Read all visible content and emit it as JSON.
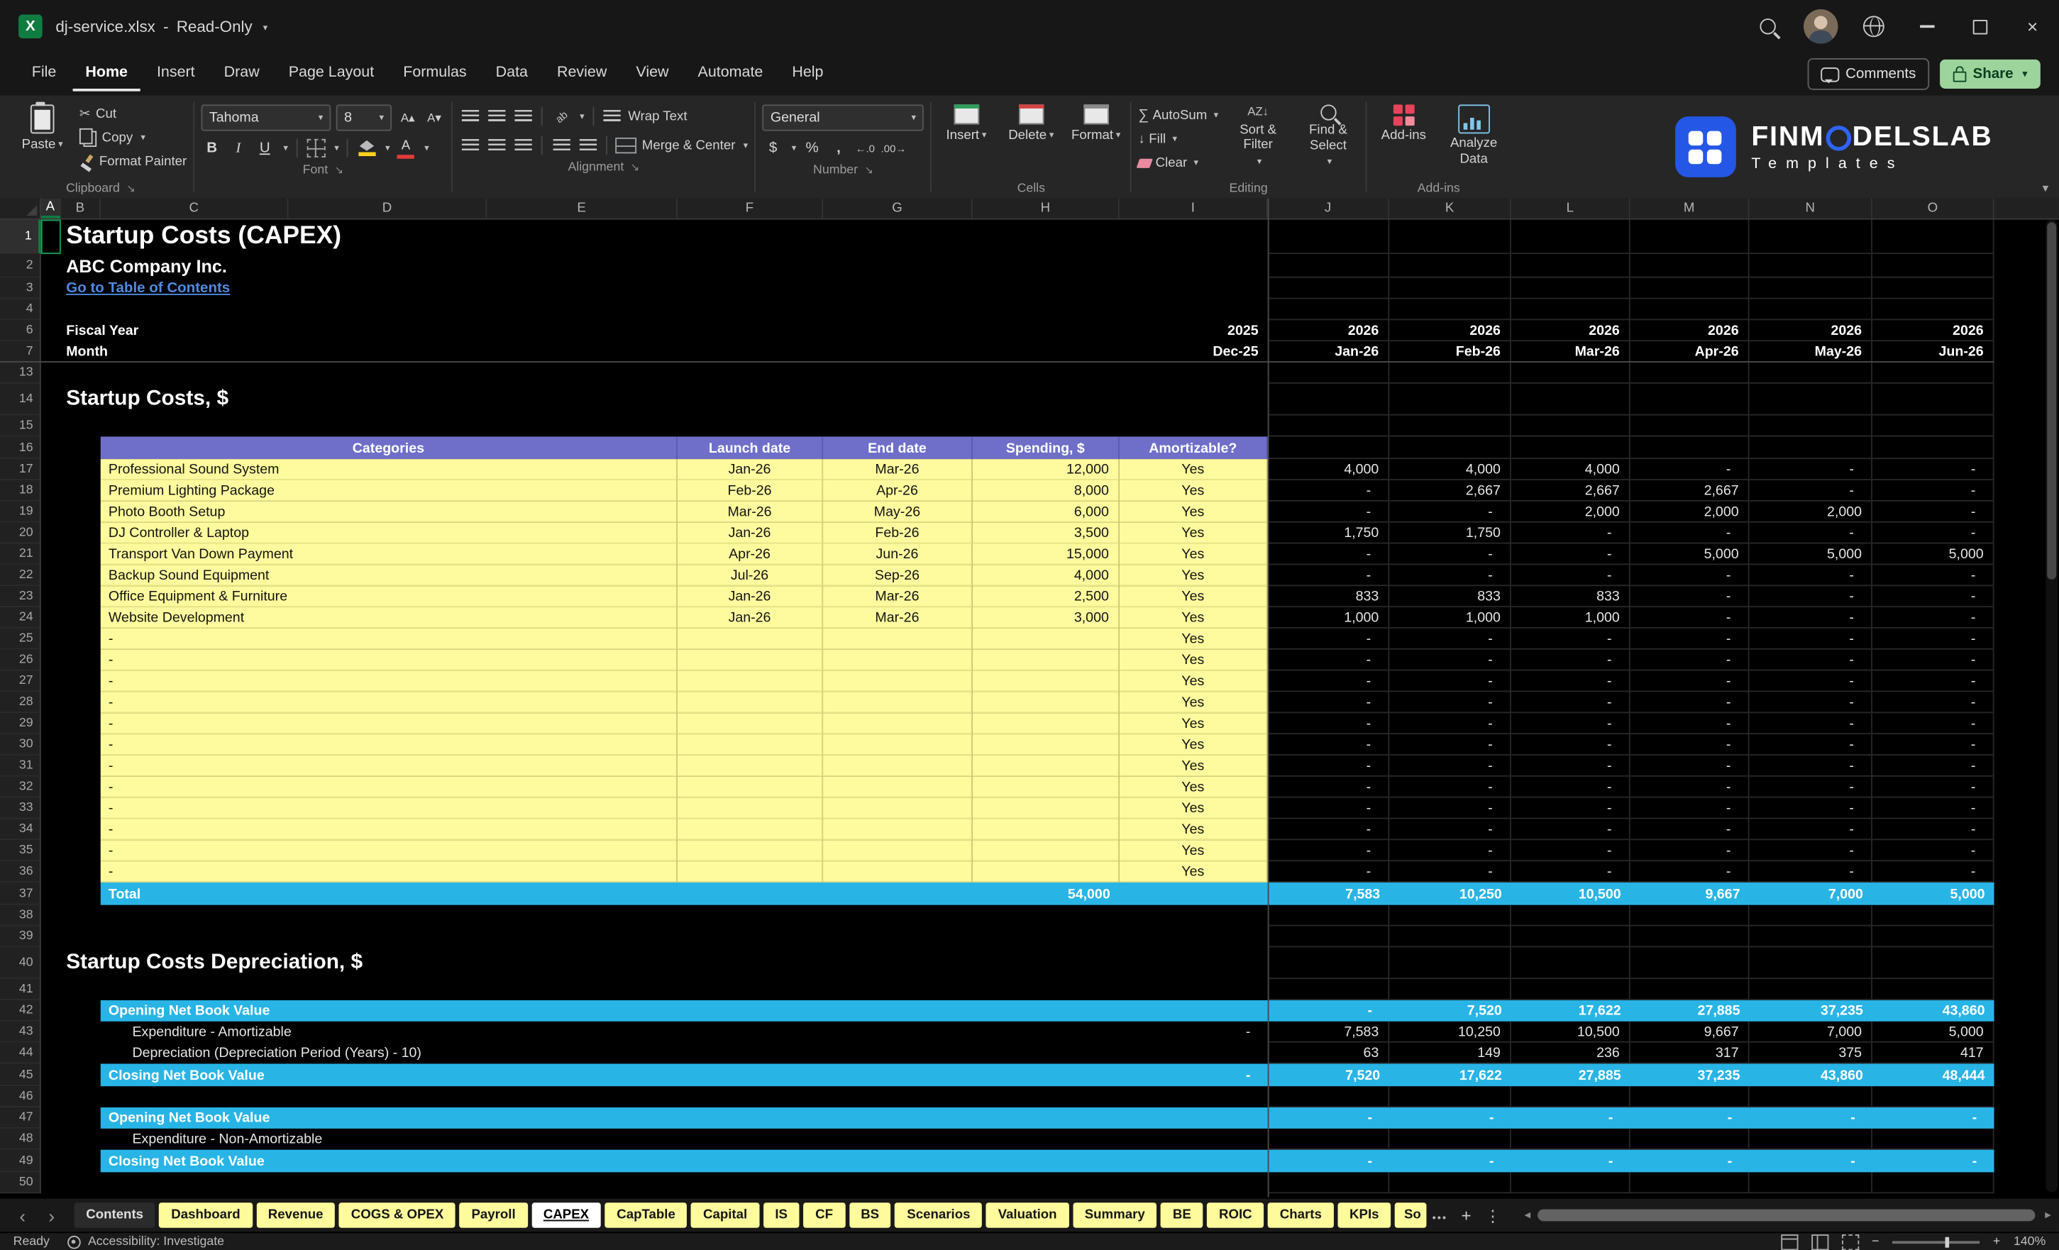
{
  "window": {
    "title": "dj-service.xlsx",
    "dash": "-",
    "mode": "Read-Only"
  },
  "menu": {
    "items": [
      "File",
      "Home",
      "Insert",
      "Draw",
      "Page Layout",
      "Formulas",
      "Data",
      "Review",
      "View",
      "Automate",
      "Help"
    ],
    "active_item": "Home",
    "comments_label": "Comments",
    "share_label": "Share"
  },
  "ribbon": {
    "paste": "Paste",
    "cut": "Cut",
    "copy": "Copy",
    "format_painter": "Format Painter",
    "font_name": "Tahoma",
    "font_size": "8",
    "wrap_text": "Wrap Text",
    "merge_center": "Merge & Center",
    "number_format": "General",
    "insert": "Insert",
    "delete": "Delete",
    "format": "Format",
    "autosum": "AutoSum",
    "fill": "Fill",
    "clear": "Clear",
    "sort_filter": "Sort & Filter",
    "find_select": "Find & Select",
    "addins": "Add-ins",
    "analyze_data": "Analyze Data",
    "groups": {
      "clipboard": "Clipboard",
      "font": "Font",
      "alignment": "Alignment",
      "number": "Number",
      "cells": "Cells",
      "editing": "Editing",
      "addins": "Add-ins"
    },
    "brand": {
      "pre": "FINM",
      "post": "DELSLAB",
      "subtitle": "Templates"
    }
  },
  "colors": {
    "band_cyan": "#29B4E6",
    "header_purple": "#6F6FC9",
    "table_yellow": "#FEFB9E",
    "link_blue": "#4F8AE0",
    "excel_green": "#107C41"
  },
  "grid": {
    "column_letters": [
      "A",
      "B",
      "C",
      "D",
      "E",
      "F",
      "G",
      "H",
      "I",
      "J",
      "K",
      "L",
      "M",
      "N",
      "O"
    ],
    "selected_column": "A",
    "selected_row": "1",
    "rows": [
      {
        "n": "1",
        "h": 26,
        "type": "title",
        "text": "Startup Costs (CAPEX)"
      },
      {
        "n": "2",
        "h": 18,
        "type": "subtitle",
        "text": "ABC Company Inc."
      },
      {
        "n": "3",
        "h": 16,
        "type": "link",
        "text": "Go to Table of Contents"
      },
      {
        "n": "4",
        "h": 16,
        "type": "blank"
      },
      {
        "n": "6",
        "h": 16,
        "type": "years",
        "label": "Fiscal Year",
        "cells": [
          "2025",
          "2026",
          "2026",
          "2026",
          "2026",
          "2026",
          "2026"
        ]
      },
      {
        "n": "7",
        "h": 16,
        "type": "years",
        "label": "Month",
        "cells": [
          "Dec-25",
          "Jan-26",
          "Feb-26",
          "Mar-26",
          "Apr-26",
          "May-26",
          "Jun-26"
        ]
      },
      {
        "n": "13",
        "h": 16,
        "type": "blank"
      },
      {
        "n": "14",
        "h": 24,
        "type": "section",
        "text": "Startup Costs, $"
      },
      {
        "n": "15",
        "h": 16,
        "type": "blank"
      },
      {
        "n": "16",
        "h": 17,
        "type": "thead",
        "cells": [
          "Categories",
          "Launch date",
          "End date",
          "Spending, $",
          "Amortizable?"
        ]
      },
      {
        "n": "17",
        "h": 16,
        "type": "item",
        "category": "Professional Sound System",
        "launch": "Jan-26",
        "end": "Mar-26",
        "spend": "12,000",
        "amort": "Yes",
        "months": [
          "4,000",
          "4,000",
          "4,000",
          "-",
          "-",
          "-"
        ]
      },
      {
        "n": "18",
        "h": 16,
        "type": "item",
        "category": "Premium Lighting Package",
        "launch": "Feb-26",
        "end": "Apr-26",
        "spend": "8,000",
        "amort": "Yes",
        "months": [
          "-",
          "2,667",
          "2,667",
          "2,667",
          "-",
          "-"
        ]
      },
      {
        "n": "19",
        "h": 16,
        "type": "item",
        "category": "Photo Booth Setup",
        "launch": "Mar-26",
        "end": "May-26",
        "spend": "6,000",
        "amort": "Yes",
        "months": [
          "-",
          "-",
          "2,000",
          "2,000",
          "2,000",
          "-"
        ]
      },
      {
        "n": "20",
        "h": 16,
        "type": "item",
        "category": "DJ Controller & Laptop",
        "launch": "Jan-26",
        "end": "Feb-26",
        "spend": "3,500",
        "amort": "Yes",
        "months": [
          "1,750",
          "1,750",
          "-",
          "-",
          "-",
          "-"
        ]
      },
      {
        "n": "21",
        "h": 16,
        "type": "item",
        "category": "Transport Van Down Payment",
        "launch": "Apr-26",
        "end": "Jun-26",
        "spend": "15,000",
        "amort": "Yes",
        "months": [
          "-",
          "-",
          "-",
          "5,000",
          "5,000",
          "5,000"
        ]
      },
      {
        "n": "22",
        "h": 16,
        "type": "item",
        "category": "Backup Sound Equipment",
        "launch": "Jul-26",
        "end": "Sep-26",
        "spend": "4,000",
        "amort": "Yes",
        "months": [
          "-",
          "-",
          "-",
          "-",
          "-",
          "-"
        ]
      },
      {
        "n": "23",
        "h": 16,
        "type": "item",
        "category": "Office Equipment & Furniture",
        "launch": "Jan-26",
        "end": "Mar-26",
        "spend": "2,500",
        "amort": "Yes",
        "months": [
          "833",
          "833",
          "833",
          "-",
          "-",
          "-"
        ]
      },
      {
        "n": "24",
        "h": 16,
        "type": "item",
        "category": "Website Development",
        "launch": "Jan-26",
        "end": "Mar-26",
        "spend": "3,000",
        "amort": "Yes",
        "months": [
          "1,000",
          "1,000",
          "1,000",
          "-",
          "-",
          "-"
        ]
      },
      {
        "n": "25",
        "h": 16,
        "type": "item",
        "category": "-",
        "launch": "",
        "end": "",
        "spend": "",
        "amort": "Yes",
        "months": [
          "-",
          "-",
          "-",
          "-",
          "-",
          "-"
        ]
      },
      {
        "n": "26",
        "h": 16,
        "type": "item",
        "category": "-",
        "launch": "",
        "end": "",
        "spend": "",
        "amort": "Yes",
        "months": [
          "-",
          "-",
          "-",
          "-",
          "-",
          "-"
        ]
      },
      {
        "n": "27",
        "h": 16,
        "type": "item",
        "category": "-",
        "launch": "",
        "end": "",
        "spend": "",
        "amort": "Yes",
        "months": [
          "-",
          "-",
          "-",
          "-",
          "-",
          "-"
        ]
      },
      {
        "n": "28",
        "h": 16,
        "type": "item",
        "category": "-",
        "launch": "",
        "end": "",
        "spend": "",
        "amort": "Yes",
        "months": [
          "-",
          "-",
          "-",
          "-",
          "-",
          "-"
        ]
      },
      {
        "n": "29",
        "h": 16,
        "type": "item",
        "category": "-",
        "launch": "",
        "end": "",
        "spend": "",
        "amort": "Yes",
        "months": [
          "-",
          "-",
          "-",
          "-",
          "-",
          "-"
        ]
      },
      {
        "n": "30",
        "h": 16,
        "type": "item",
        "category": "-",
        "launch": "",
        "end": "",
        "spend": "",
        "amort": "Yes",
        "months": [
          "-",
          "-",
          "-",
          "-",
          "-",
          "-"
        ]
      },
      {
        "n": "31",
        "h": 16,
        "type": "item",
        "category": "-",
        "launch": "",
        "end": "",
        "spend": "",
        "amort": "Yes",
        "months": [
          "-",
          "-",
          "-",
          "-",
          "-",
          "-"
        ]
      },
      {
        "n": "32",
        "h": 16,
        "type": "item",
        "category": "-",
        "launch": "",
        "end": "",
        "spend": "",
        "amort": "Yes",
        "months": [
          "-",
          "-",
          "-",
          "-",
          "-",
          "-"
        ]
      },
      {
        "n": "33",
        "h": 16,
        "type": "item",
        "category": "-",
        "launch": "",
        "end": "",
        "spend": "",
        "amort": "Yes",
        "months": [
          "-",
          "-",
          "-",
          "-",
          "-",
          "-"
        ]
      },
      {
        "n": "34",
        "h": 16,
        "type": "item",
        "category": "-",
        "launch": "",
        "end": "",
        "spend": "",
        "amort": "Yes",
        "months": [
          "-",
          "-",
          "-",
          "-",
          "-",
          "-"
        ]
      },
      {
        "n": "35",
        "h": 16,
        "type": "item",
        "category": "-",
        "launch": "",
        "end": "",
        "spend": "",
        "amort": "Yes",
        "months": [
          "-",
          "-",
          "-",
          "-",
          "-",
          "-"
        ]
      },
      {
        "n": "36",
        "h": 16,
        "type": "item",
        "category": "-",
        "launch": "",
        "end": "",
        "spend": "",
        "amort": "Yes",
        "months": [
          "-",
          "-",
          "-",
          "-",
          "-",
          "-"
        ]
      },
      {
        "n": "37",
        "h": 17,
        "type": "total",
        "label": "Total",
        "spend": "54,000",
        "months": [
          "7,583",
          "10,250",
          "10,500",
          "9,667",
          "7,000",
          "5,000"
        ]
      },
      {
        "n": "38",
        "h": 16,
        "type": "blank"
      },
      {
        "n": "39",
        "h": 16,
        "type": "blank"
      },
      {
        "n": "40",
        "h": 24,
        "type": "section",
        "text": "Startup Costs Depreciation, $"
      },
      {
        "n": "41",
        "h": 16,
        "type": "blank"
      },
      {
        "n": "42",
        "h": 16,
        "type": "band",
        "label": "Opening Net Book Value",
        "dec": "",
        "months": [
          "-",
          "7,520",
          "17,622",
          "27,885",
          "37,235",
          "43,860"
        ]
      },
      {
        "n": "43",
        "h": 16,
        "type": "plain",
        "label": "Expenditure - Amortizable",
        "dec": "-",
        "months": [
          "7,583",
          "10,250",
          "10,500",
          "9,667",
          "7,000",
          "5,000"
        ]
      },
      {
        "n": "44",
        "h": 16,
        "type": "plain",
        "label": "Depreciation (Depreciation Period (Years) - 10)",
        "dec": "",
        "months": [
          "63",
          "149",
          "236",
          "317",
          "375",
          "417"
        ]
      },
      {
        "n": "45",
        "h": 17,
        "type": "band",
        "label": "Closing Net Book Value",
        "dec": "-",
        "months": [
          "7,520",
          "17,622",
          "27,885",
          "37,235",
          "43,860",
          "48,444"
        ]
      },
      {
        "n": "46",
        "h": 16,
        "type": "blank"
      },
      {
        "n": "47",
        "h": 16,
        "type": "band",
        "label": "Opening Net Book Value",
        "dec": "",
        "months": [
          "-",
          "-",
          "-",
          "-",
          "-",
          "-"
        ]
      },
      {
        "n": "48",
        "h": 16,
        "type": "plain",
        "label": "Expenditure - Non-Amortizable",
        "dec": "",
        "months": [
          "",
          "",
          "",
          "",
          "",
          ""
        ]
      },
      {
        "n": "49",
        "h": 17,
        "type": "band",
        "label": "Closing Net Book Value",
        "dec": "",
        "months": [
          "-",
          "-",
          "-",
          "-",
          "-",
          "-"
        ]
      },
      {
        "n": "50",
        "h": 16,
        "type": "blank"
      }
    ]
  },
  "sheet_tabs": {
    "items": [
      {
        "label": "Contents",
        "style": "plain"
      },
      {
        "label": "Dashboard",
        "style": "yellow"
      },
      {
        "label": "Revenue",
        "style": "yellow"
      },
      {
        "label": "COGS & OPEX",
        "style": "yellow"
      },
      {
        "label": "Payroll",
        "style": "yellow"
      },
      {
        "label": "CAPEX",
        "style": "active"
      },
      {
        "label": "CapTable",
        "style": "yellow"
      },
      {
        "label": "Capital",
        "style": "yellow"
      },
      {
        "label": "IS",
        "style": "yellow"
      },
      {
        "label": "CF",
        "style": "yellow"
      },
      {
        "label": "BS",
        "style": "yellow"
      },
      {
        "label": "Scenarios",
        "style": "yellow"
      },
      {
        "label": "Valuation",
        "style": "yellow"
      },
      {
        "label": "Summary",
        "style": "yellow"
      },
      {
        "label": "BE",
        "style": "yellow"
      },
      {
        "label": "ROIC",
        "style": "yellow"
      },
      {
        "label": "Charts",
        "style": "yellow"
      },
      {
        "label": "KPIs",
        "style": "yellow"
      },
      {
        "label": "So",
        "style": "yellow-cut"
      }
    ]
  },
  "status": {
    "ready": "Ready",
    "accessibility": "Accessibility: Investigate",
    "zoom": "140%"
  }
}
